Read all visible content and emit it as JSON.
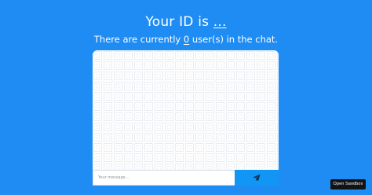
{
  "header": {
    "title_prefix": "Your ID is ",
    "id_value": "...",
    "count_prefix": "There are currently ",
    "user_count": "0",
    "count_suffix": " user(s) in the chat."
  },
  "chat": {
    "input_placeholder": "Your message...",
    "input_value": "",
    "send_icon": "paper-plane-icon"
  },
  "sandbox": {
    "button_label": "Open Sandbox"
  },
  "colors": {
    "background": "#1f8cf3",
    "send_button": "#1196f5",
    "sandbox_button": "#111315"
  }
}
